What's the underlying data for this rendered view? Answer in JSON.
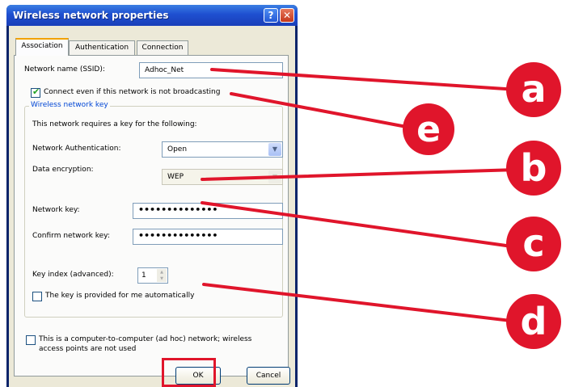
{
  "window": {
    "title": "Wireless network properties",
    "help_glyph": "?",
    "close_glyph": "✕"
  },
  "tabs": [
    "Association",
    "Authentication",
    "Connection"
  ],
  "association": {
    "ssid_label": "Network name (SSID):",
    "ssid_value": "Adhoc_Net",
    "broadcast_checkbox_label": "Connect even if this network is not broadcasting",
    "broadcast_checked": true,
    "group_title": "Wireless network key",
    "key_required_text": "This network requires a key for the following:",
    "auth_label": "Network Authentication:",
    "auth_value": "Open",
    "encryption_label": "Data encryption:",
    "encryption_value": "WEP",
    "network_key_label": "Network key:",
    "network_key_value": "••••••••••••••",
    "confirm_key_label": "Confirm network key:",
    "confirm_key_value": "••••••••••••••",
    "key_index_label": "Key index (advanced):",
    "key_index_value": "1",
    "auto_key_label": "The key is provided for me automatically",
    "auto_key_checked": false,
    "adhoc_label_line1": "This is a computer-to-computer (ad hoc) network; wireless",
    "adhoc_label_line2": "access points are not used",
    "adhoc_checked": false
  },
  "buttons": {
    "ok": "OK",
    "cancel": "Cancel"
  },
  "annotations": {
    "color": "#e0152b",
    "labels": [
      "a",
      "e",
      "b",
      "c",
      "d"
    ]
  }
}
